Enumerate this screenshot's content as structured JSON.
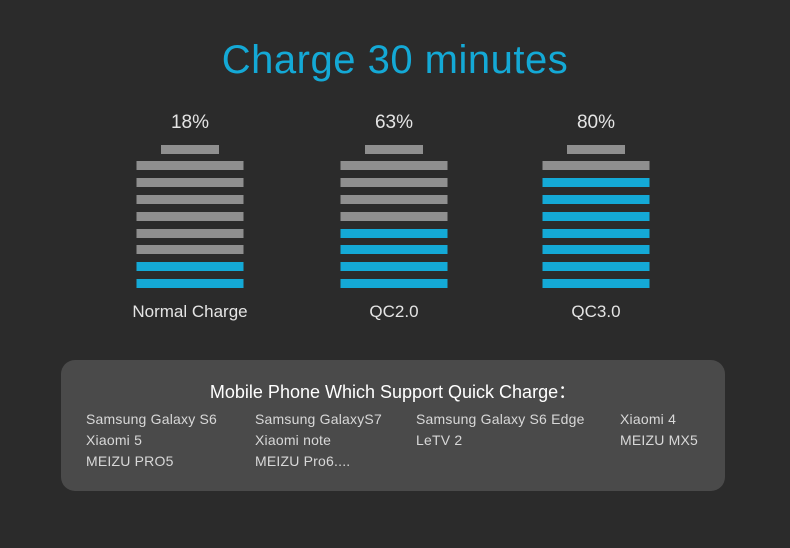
{
  "title": "Charge 30 minutes",
  "batteries": [
    {
      "percent_label": "18%",
      "label": "Normal Charge",
      "filled_bars": 2,
      "total_bars": 8
    },
    {
      "percent_label": "63%",
      "label": "QC2.0",
      "filled_bars": 4,
      "total_bars": 8
    },
    {
      "percent_label": "80%",
      "label": "QC3.0",
      "filled_bars": 7,
      "total_bars": 8
    }
  ],
  "colors": {
    "accent": "#14a9d6",
    "empty_bar": "#8f8f8f",
    "background": "#2b2b2b",
    "panel": "#4a4a4a"
  },
  "panel": {
    "title": "Mobile Phone Which Support Quick Charge：",
    "phones": [
      "Samsung Galaxy S6",
      "Samsung GalaxyS7",
      "Samsung Galaxy S6 Edge",
      "Xiaomi 4",
      "Xiaomi 5",
      "Xiaomi note",
      "LeTV 2",
      "MEIZU MX5",
      "MEIZU PRO5",
      "MEIZU Pro6...."
    ]
  }
}
